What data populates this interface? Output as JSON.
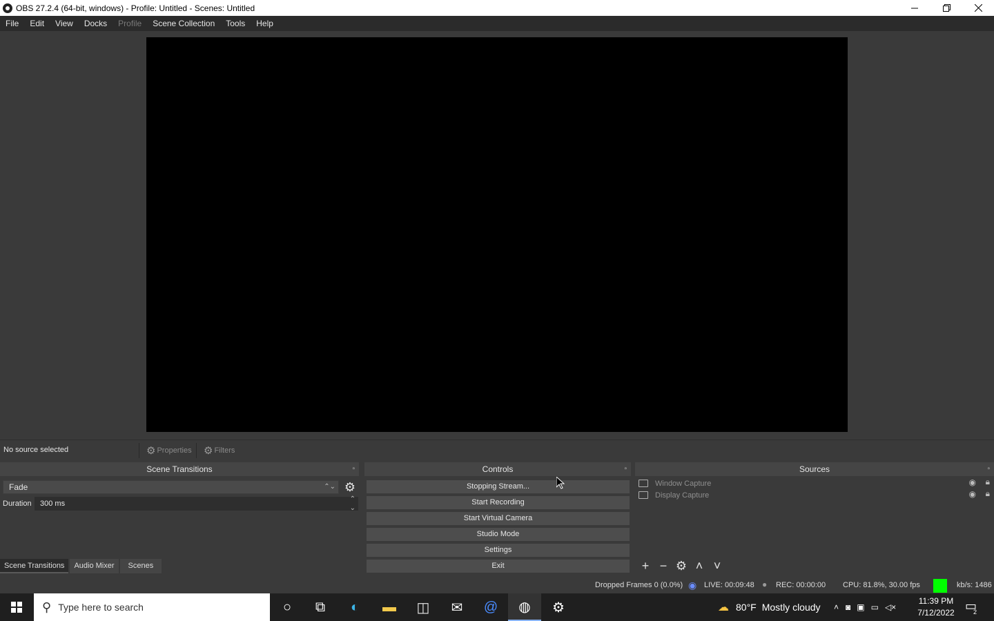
{
  "window": {
    "title": "OBS 27.2.4 (64-bit, windows) - Profile: Untitled - Scenes: Untitled",
    "minimize_icon": "minimize-icon",
    "restore_icon": "restore-icon",
    "close_icon": "close-icon"
  },
  "menu": [
    "File",
    "Edit",
    "View",
    "Docks",
    "Profile",
    "Scene Collection",
    "Tools",
    "Help"
  ],
  "context_bar": {
    "status": "No source selected",
    "properties_label": "Properties",
    "filters_label": "Filters"
  },
  "scene_transitions": {
    "title": "Scene Transitions",
    "transition": "Fade",
    "duration_label": "Duration",
    "duration_value": "300 ms"
  },
  "dock_tabs": [
    "Scene Transitions",
    "Audio Mixer",
    "Scenes"
  ],
  "controls": {
    "title": "Controls",
    "buttons": [
      "Stopping Stream...",
      "Start Recording",
      "Start Virtual Camera",
      "Studio Mode",
      "Settings",
      "Exit"
    ]
  },
  "sources": {
    "title": "Sources",
    "items": [
      "Window Capture",
      "Display Capture"
    ]
  },
  "status_bar": {
    "dropped_frames": "Dropped Frames 0 (0.0%)",
    "live": "LIVE: 00:09:48",
    "rec": "REC: 00:00:00",
    "cpu": "CPU: 81.8%, 30.00 fps",
    "kbs": "kb/s: 1486",
    "status_color": "#00ff00"
  },
  "taskbar": {
    "search_placeholder": "Type here to search",
    "weather_temp": "80°F",
    "weather_text": "Mostly cloudy",
    "time": "11:39 PM",
    "date": "7/12/2022",
    "notification_count": "2"
  }
}
